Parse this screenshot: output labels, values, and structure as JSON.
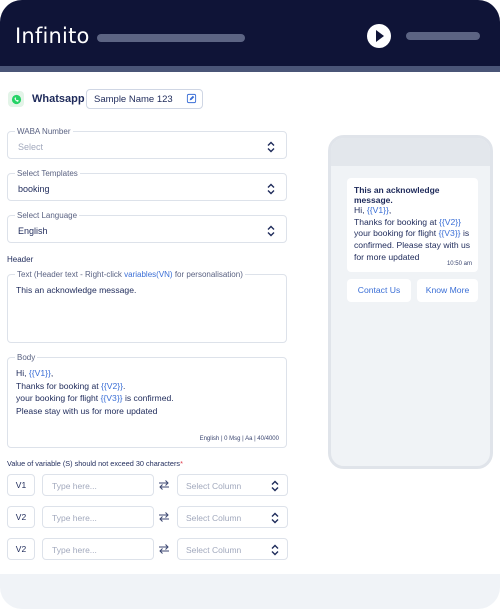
{
  "app": {
    "title": "Infinito"
  },
  "channel": {
    "name": "Whatsapp",
    "icon": "whatsapp-icon"
  },
  "template_name": {
    "value": "Sample Name 123",
    "icon": "edit-icon"
  },
  "fields": {
    "waba": {
      "label": "WABA Number",
      "value": "Select"
    },
    "templates": {
      "label": "Select Templates",
      "value": "booking"
    },
    "language": {
      "label": "Select Language",
      "value": "English"
    }
  },
  "header": {
    "section_label": "Header",
    "text_label_prefix": "Text (Header text - Right-click ",
    "text_label_link": "variables(VN)",
    "text_label_suffix": " for personalisation)",
    "text_value": "This an acknowledge message."
  },
  "body": {
    "label": "Body",
    "greeting": "Hi, ",
    "v1": "{{V1}}",
    "comma": ",",
    "line2_prefix": "Thanks for booking at ",
    "v2": "{{V2}}",
    "line2_suffix": ".",
    "line3_prefix": "your booking for flight ",
    "v3": "{{V3}}",
    "line3_suffix": " is confirmed.",
    "line4": "Please stay with us for more updated",
    "counter": "English  |  0 Msg  |  Aa  |  40/4000"
  },
  "variables": {
    "warning": "Value of variable (S) should not exceed 30 characters",
    "required_mark": "*",
    "rows": [
      {
        "tag": "V1",
        "placeholder": "Type here...",
        "select": "Select Column"
      },
      {
        "tag": "V2",
        "placeholder": "Type here...",
        "select": "Select Column"
      },
      {
        "tag": "V2",
        "placeholder": "Type here...",
        "select": "Select Column"
      }
    ]
  },
  "preview": {
    "header": "This an acknowledge message.",
    "greeting": "Hi, ",
    "v1": "{{V1}}",
    "comma": ",",
    "line2_prefix": "Thanks for booking at ",
    "v2": "{{V2}}",
    "line3_prefix": "your booking for flight ",
    "v3": "{{V3}}",
    "line3_suffix": " is confirmed. Please stay with us for more updated",
    "time": "10:50 am",
    "buttons": [
      "Contact Us",
      "Know More"
    ]
  },
  "colors": {
    "topbar": "#0f1437",
    "accent": "#3b6fd6",
    "text": "#1e2a5a",
    "whatsapp": "#25d366",
    "required": "#e0394a"
  }
}
